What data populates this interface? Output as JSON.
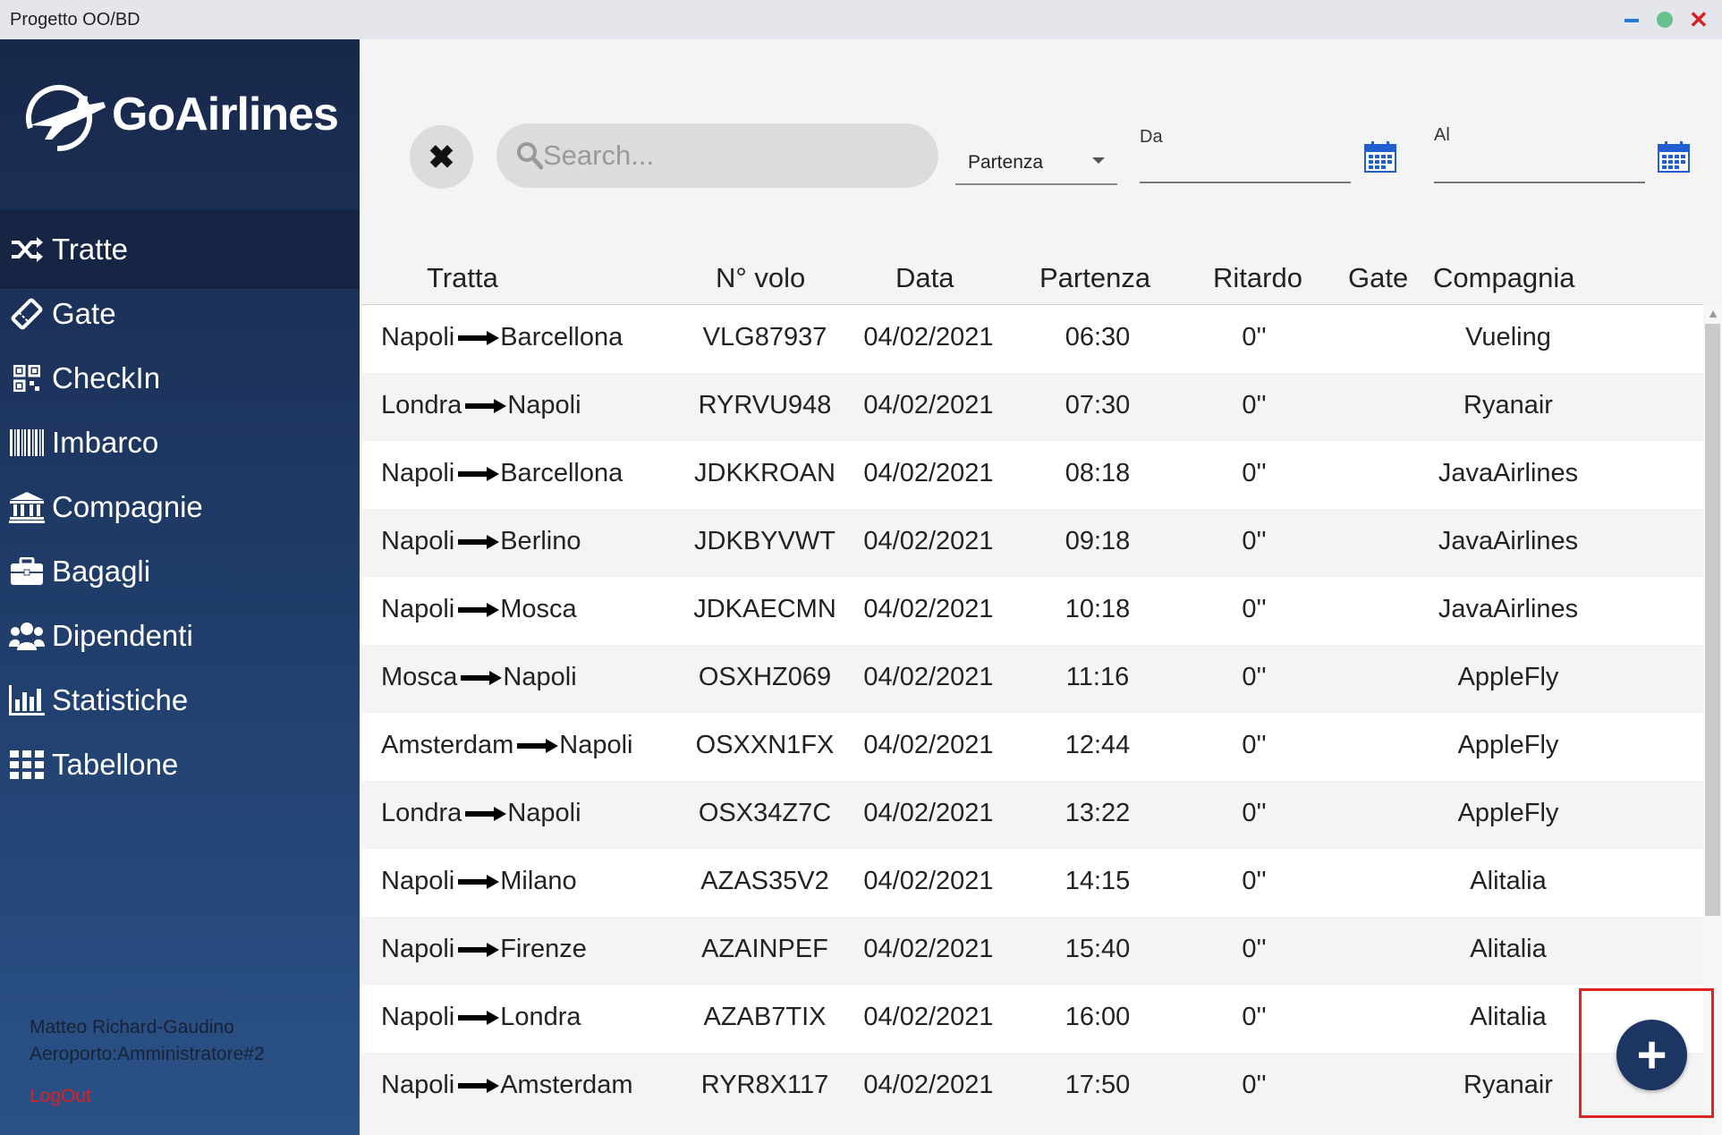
{
  "window": {
    "title": "Progetto OO/BD"
  },
  "app": {
    "brand": "GoAirlines"
  },
  "sidebar": {
    "items": [
      {
        "label": "Tratte",
        "icon": "shuffle-icon",
        "active": true
      },
      {
        "label": "Gate",
        "icon": "ticket-icon",
        "active": false
      },
      {
        "label": "CheckIn",
        "icon": "qrcode-icon",
        "active": false
      },
      {
        "label": "Imbarco",
        "icon": "barcode-icon",
        "active": false
      },
      {
        "label": "Compagnie",
        "icon": "bank-icon",
        "active": false
      },
      {
        "label": "Bagagli",
        "icon": "briefcase-icon",
        "active": false
      },
      {
        "label": "Dipendenti",
        "icon": "users-icon",
        "active": false
      },
      {
        "label": "Statistiche",
        "icon": "bar-chart-icon",
        "active": false
      },
      {
        "label": "Tabellone",
        "icon": "grid-icon",
        "active": false
      }
    ],
    "user_name": "Matteo Richard-Gaudino",
    "user_role": "Aeroporto:Amministratore#2",
    "logout": "LogOut"
  },
  "toolbar": {
    "clear_icon": "✖",
    "search_placeholder": "Search...",
    "filter_value": "Partenza",
    "from_label": "Da",
    "to_label": "Al"
  },
  "table": {
    "columns": [
      "Tratta",
      "N° volo",
      "Data",
      "Partenza",
      "Ritardo",
      "Gate",
      "Compagnia"
    ],
    "rows": [
      {
        "from": "Napoli",
        "to": "Barcellona",
        "flight": "VLG87937",
        "date": "04/02/2021",
        "time": "06:30",
        "delay": "0''",
        "gate": "",
        "company": "Vueling"
      },
      {
        "from": "Londra",
        "to": "Napoli",
        "flight": "RYRVU948",
        "date": "04/02/2021",
        "time": "07:30",
        "delay": "0''",
        "gate": "",
        "company": "Ryanair"
      },
      {
        "from": "Napoli",
        "to": "Barcellona",
        "flight": "JDKKROAN",
        "date": "04/02/2021",
        "time": "08:18",
        "delay": "0''",
        "gate": "",
        "company": "JavaAirlines"
      },
      {
        "from": "Napoli",
        "to": "Berlino",
        "flight": "JDKBYVWT",
        "date": "04/02/2021",
        "time": "09:18",
        "delay": "0''",
        "gate": "",
        "company": "JavaAirlines"
      },
      {
        "from": "Napoli",
        "to": "Mosca",
        "flight": "JDKAECMN",
        "date": "04/02/2021",
        "time": "10:18",
        "delay": "0''",
        "gate": "",
        "company": "JavaAirlines"
      },
      {
        "from": "Mosca",
        "to": "Napoli",
        "flight": "OSXHZ069",
        "date": "04/02/2021",
        "time": "11:16",
        "delay": "0''",
        "gate": "",
        "company": "AppleFly"
      },
      {
        "from": "Amsterdam",
        "to": "Napoli",
        "flight": "OSXXN1FX",
        "date": "04/02/2021",
        "time": "12:44",
        "delay": "0''",
        "gate": "",
        "company": "AppleFly"
      },
      {
        "from": "Londra",
        "to": "Napoli",
        "flight": "OSX34Z7C",
        "date": "04/02/2021",
        "time": "13:22",
        "delay": "0''",
        "gate": "",
        "company": "AppleFly"
      },
      {
        "from": "Napoli",
        "to": "Milano",
        "flight": "AZAS35V2",
        "date": "04/02/2021",
        "time": "14:15",
        "delay": "0''",
        "gate": "",
        "company": "Alitalia"
      },
      {
        "from": "Napoli",
        "to": "Firenze",
        "flight": "AZAINPEF",
        "date": "04/02/2021",
        "time": "15:40",
        "delay": "0''",
        "gate": "",
        "company": "Alitalia"
      },
      {
        "from": "Napoli",
        "to": "Londra",
        "flight": "AZAB7TIX",
        "date": "04/02/2021",
        "time": "16:00",
        "delay": "0''",
        "gate": "",
        "company": "Alitalia"
      },
      {
        "from": "Napoli",
        "to": "Amsterdam",
        "flight": "RYR8X117",
        "date": "04/02/2021",
        "time": "17:50",
        "delay": "0''",
        "gate": "",
        "company": "Ryanair"
      }
    ]
  },
  "fab": {
    "label": "+",
    "icon": "plus-icon"
  },
  "colors": {
    "sidebar_top": "#18284a",
    "sidebar_bottom": "#2a5288",
    "accent": "#1c3562",
    "calendar": "#1f5fcf",
    "logout": "#e01f1f",
    "highlight": "#e02424"
  }
}
